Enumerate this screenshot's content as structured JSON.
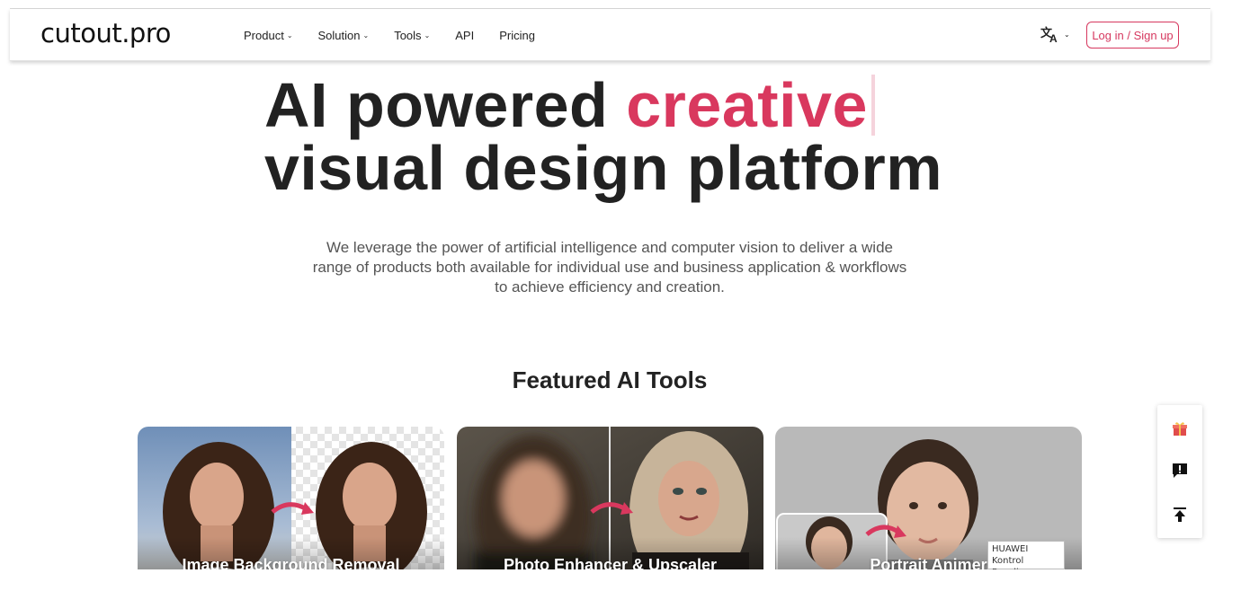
{
  "header": {
    "logo": "cutout.pro",
    "nav": [
      {
        "label": "Product",
        "has_dropdown": true
      },
      {
        "label": "Solution",
        "has_dropdown": true
      },
      {
        "label": "Tools",
        "has_dropdown": true
      },
      {
        "label": "API",
        "has_dropdown": false
      },
      {
        "label": "Pricing",
        "has_dropdown": false
      }
    ],
    "language_icon": "translate-icon",
    "login_label": "Log in / Sign up"
  },
  "hero": {
    "title_part1": "AI powered ",
    "title_accent": "creative",
    "title_line2": "visual design platform",
    "description": "We leverage the power of artificial intelligence and computer vision to deliver a wide range of products both available for individual use and business application & workflows to achieve efficiency and creation."
  },
  "featured": {
    "title": "Featured AI Tools",
    "cards": [
      {
        "label": "Image Background Removal"
      },
      {
        "label": "Photo Enhancer & Upscaler"
      },
      {
        "label": "Portrait Animer"
      }
    ]
  },
  "tooltip": {
    "line1": "HUAWEI Kontrol",
    "line2": "Paneli"
  },
  "sidebar": {
    "icons": [
      "gift-icon",
      "feedback-icon",
      "back-to-top-icon"
    ]
  },
  "colors": {
    "accent": "#d9385e",
    "text": "#222222",
    "muted": "#555555"
  }
}
